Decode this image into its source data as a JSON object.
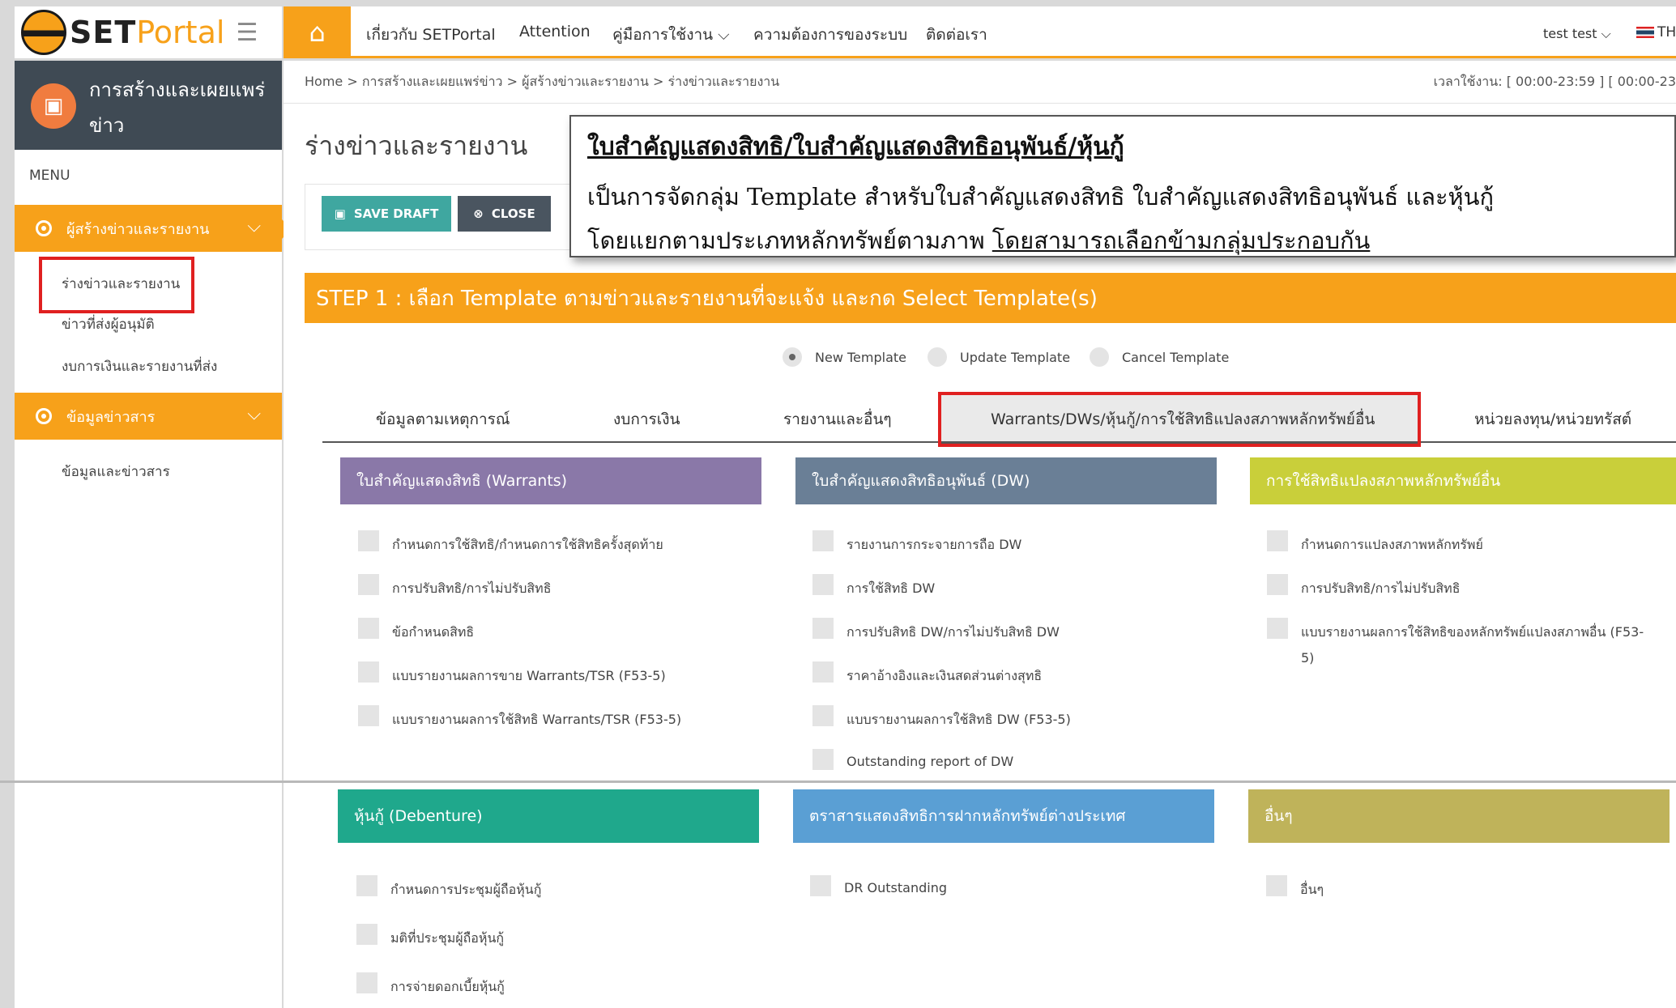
{
  "brand": {
    "set": "SET",
    "portal": "Portal"
  },
  "topnav": {
    "items": [
      "เกี่ยวกับ SETPortal",
      "Attention",
      "คู่มือการใช้งาน ⌵",
      "ความต้องการของระบบ",
      "ติดต่อเรา"
    ],
    "user": "test test ⌵",
    "lang": "TH"
  },
  "sidebar": {
    "title": "การสร้างและเผยแพร่ข่าว",
    "menu_label": "MENU",
    "group1": "ผู้สร้างข่าวและรายงาน",
    "group1_items": [
      "ร่างข่าวและรายงาน",
      "ข่าวที่ส่งผู้อนุมัติ",
      "งบการเงินและรายงานที่ส่ง"
    ],
    "group2": "ข้อมูลข่าวสาร",
    "group2_items": [
      "ข้อมูลและข่าวสาร"
    ]
  },
  "breadcrumb": "Home  >  การสร้างและเผยแพร่ข่าว  >  ผู้สร้างข่าวและรายงาน  >  ร่างข่าวและรายงาน",
  "usage_time": "เวลาใช้งาน: [ 00:00-23:59 ] [ 00:00-23",
  "page_title": "ร่างข่าวและรายงาน",
  "toolbar": {
    "save_draft": "SAVE DRAFT",
    "close": "CLOSE"
  },
  "callout": {
    "title": "ใบสำคัญแสดงสิทธิ/ใบสำคัญแสดงสิทธิอนุพันธ์/หุ้นกู้",
    "line1": "เป็นการจัดกลุ่ม Template สำหรับใบสำคัญแสดงสิทธิ ใบสำคัญแสดงสิทธิอนุพันธ์ และหุ้นกู้",
    "line2_plain": "โดยแยกตามประเภทหลักทรัพย์ตามภาพ ",
    "line2_underlined": "โดยสามารถเลือกข้ามกลุ่มประกอบกัน"
  },
  "step": "STEP 1 : เลือก Template ตามข่าวและรายงานที่จะแจ้ง และกด Select Template(s)",
  "radios": {
    "new": "New Template",
    "update": "Update Template",
    "cancel": "Cancel Template",
    "selected": "New Template"
  },
  "tabs": [
    "ข้อมูลตามเหตุการณ์",
    "งบการเงิน",
    "รายงานและอื่นๆ",
    "Warrants/DWs/หุ้นกู้/การใช้สิทธิแปลงสภาพหลักทรัพย์อื่น",
    "หน่วยลงทุน/หน่วยทรัสต์"
  ],
  "active_tab": "Warrants/DWs/หุ้นกู้/การใช้สิทธิแปลงสภาพหลักทรัพย์อื่น",
  "categories": [
    {
      "title": "ใบสำคัญแสดงสิทธิ (Warrants)",
      "color": "#8a78a8",
      "items": [
        "กำหนดการใช้สิทธิ/กำหนดการใช้สิทธิครั้งสุดท้าย",
        "การปรับสิทธิ/การไม่ปรับสิทธิ",
        "ข้อกำหนดสิทธิ",
        "แบบรายงานผลการขาย Warrants/TSR (F53-5)",
        "แบบรายงานผลการใช้สิทธิ Warrants/TSR (F53-5)"
      ]
    },
    {
      "title": "ใบสำคัญแสดงสิทธิอนุพันธ์ (DW)",
      "color": "#6a7f96",
      "items": [
        "รายงานการกระจายการถือ DW",
        "การใช้สิทธิ DW",
        "การปรับสิทธิ DW/การไม่ปรับสิทธิ DW",
        "ราคาอ้างอิงและเงินสดส่วนต่างสุทธิ",
        "แบบรายงานผลการใช้สิทธิ DW (F53-5)",
        "Outstanding report of DW"
      ]
    },
    {
      "title": "การใช้สิทธิแปลงสภาพหลักทรัพย์อื่น",
      "color": "#c9cf3a",
      "items": [
        "กำหนดการแปลงสภาพหลักทรัพย์",
        "การปรับสิทธิ/การไม่ปรับสิทธิ",
        "แบบรายงานผลการใช้สิทธิของหลักทรัพย์แปลงสภาพอื่น (F53-",
        "5)"
      ]
    },
    {
      "title": "หุ้นกู้ (Debenture)",
      "color": "#1fa88c",
      "items": [
        "กำหนดการประชุมผู้ถือหุ้นกู้",
        "มติที่ประชุมผู้ถือหุ้นกู้",
        "การจ่ายดอกเบี้ยหุ้นกู้"
      ]
    },
    {
      "title": "ตราสารแสดงสิทธิการฝากหลักทรัพย์ต่างประเทศ",
      "color": "#5a9fd4",
      "items": [
        "DR Outstanding"
      ]
    },
    {
      "title": "อื่นๆ",
      "color": "#bfb35a",
      "items": [
        "อื่นๆ"
      ]
    }
  ]
}
